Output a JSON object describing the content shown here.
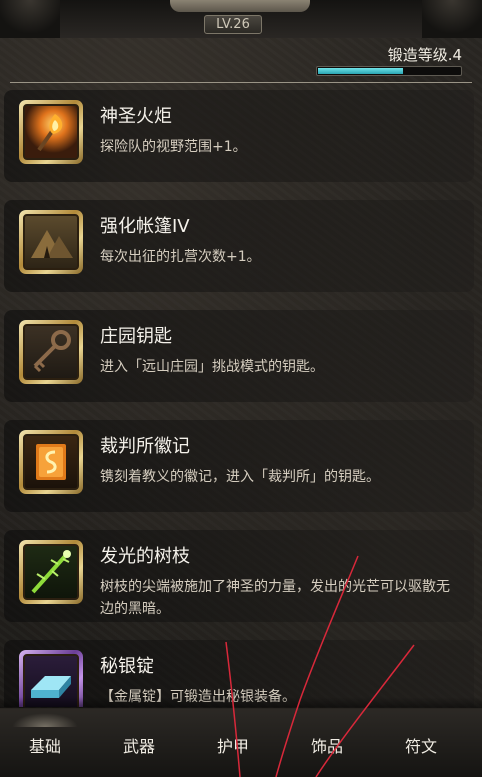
{
  "header": {
    "level": "LV.26",
    "forge_label": "锻造等级.4",
    "forge_progress": 0.6
  },
  "items": [
    {
      "name": "神圣火炬",
      "desc": "探险队的视野范围+1。",
      "icon": "torch-icon"
    },
    {
      "name": "强化帐篷IV",
      "desc": "每次出征的扎营次数+1。",
      "icon": "tent-icon"
    },
    {
      "name": "庄园钥匙",
      "desc": "进入「远山庄园」挑战模式的钥匙。",
      "icon": "key-icon"
    },
    {
      "name": "裁判所徽记",
      "desc": "镌刻着教义的徽记，进入「裁判所」的钥匙。",
      "icon": "emblem-icon"
    },
    {
      "name": "发光的树枝",
      "desc": "树枝的尖端被施加了神圣的力量，发出的光芒可以驱散无边的黑暗。",
      "icon": "glowing-branch-icon"
    },
    {
      "name": "秘银锭",
      "desc": "【金属锭】可锻造出秘银装备。",
      "icon": "mithril-ingot-icon"
    }
  ],
  "tabs": [
    {
      "label": "基础",
      "active": true
    },
    {
      "label": "武器",
      "active": false
    },
    {
      "label": "护甲",
      "active": false
    },
    {
      "label": "饰品",
      "active": false
    },
    {
      "label": "符文",
      "active": false
    }
  ],
  "colors": {
    "forge_bar": "#2aa5b3",
    "gold_frame": "#b28a3a",
    "purple_frame": "#6b3e96",
    "scribble": "#d8283a"
  }
}
